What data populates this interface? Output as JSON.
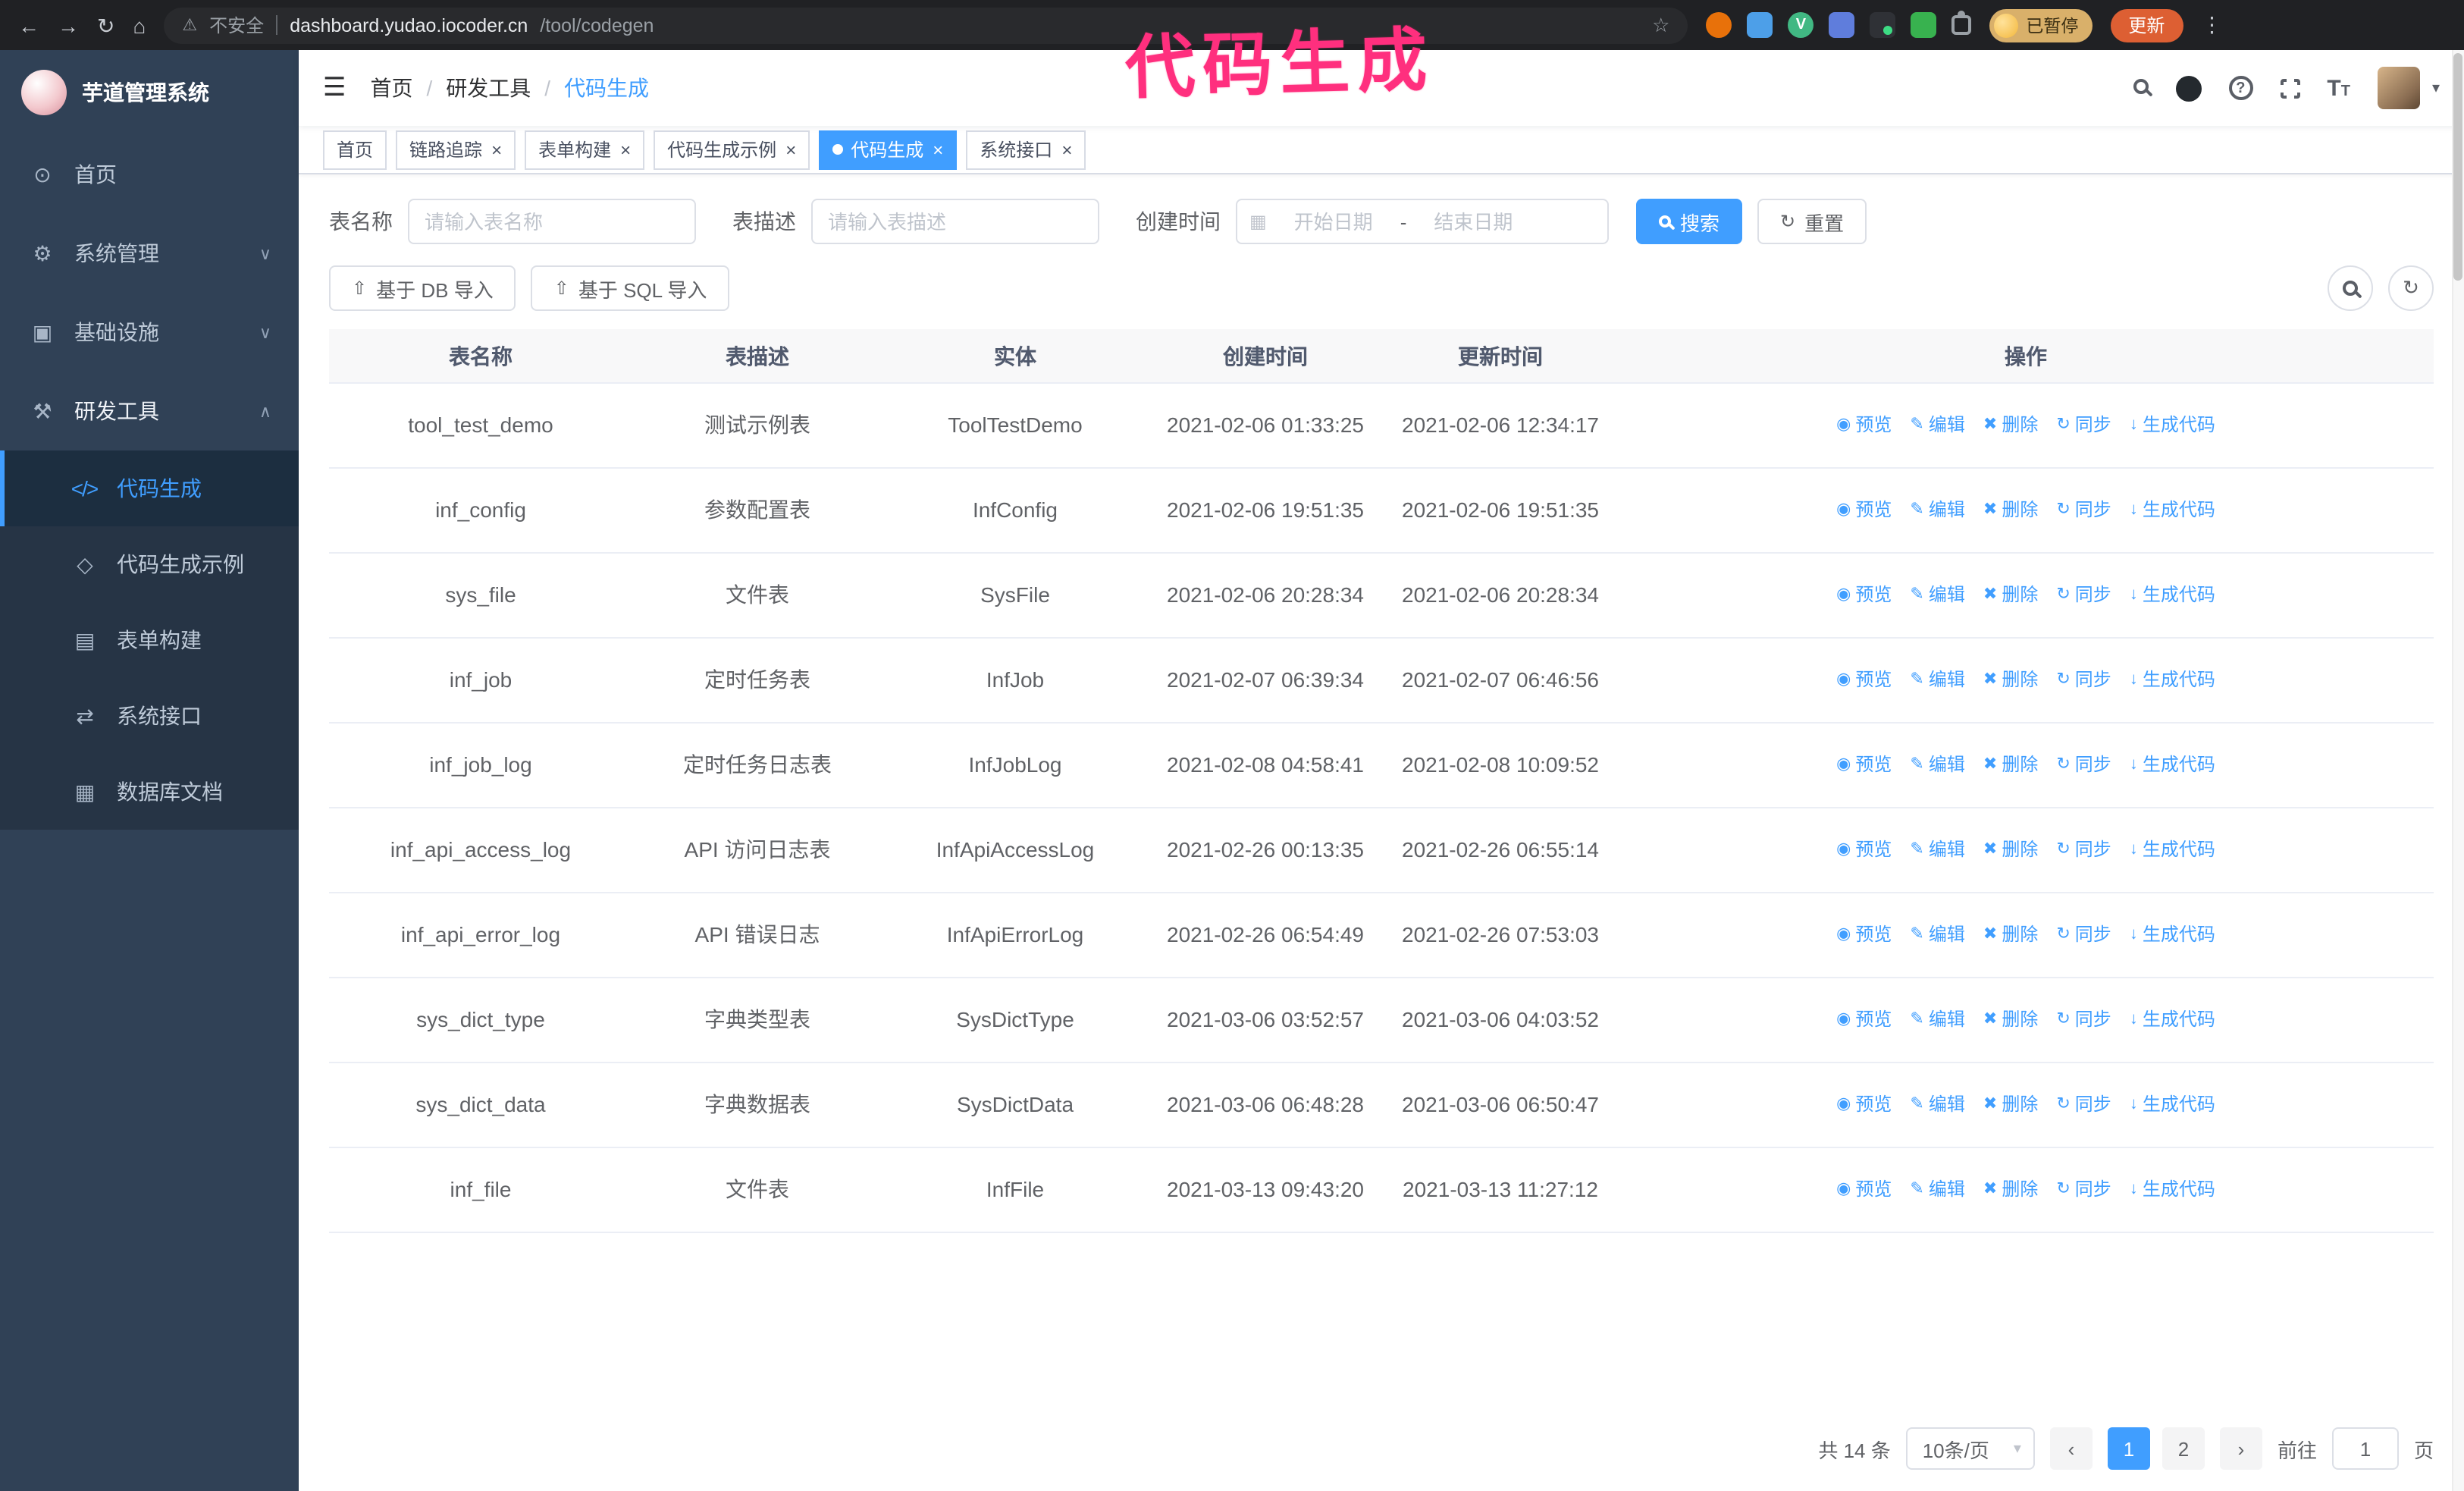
{
  "theme": {
    "accent": "#409eff",
    "sidebar_bg": "#304156",
    "submenu_bg": "#263445",
    "annotation_pink": "#ff2f7e",
    "chrome_bg": "#202124",
    "update_button_bg": "#dd5f33",
    "paused_chip_bg": "#d9b06a"
  },
  "annotation": {
    "text": "代码生成"
  },
  "browser": {
    "security_label": "不安全",
    "url_domain": "dashboard.yudao.iocoder.cn",
    "url_path": "/tool/codegen",
    "paused_badge": "已暂停",
    "update_button": "更新"
  },
  "icons": {
    "back-icon": "←",
    "forward-icon": "→",
    "reload-icon": "↻",
    "home-icon": "⌂",
    "warning-icon": "⚠",
    "star-icon": "☆",
    "kebab-icon": "⋮",
    "hamburger-icon": "☰",
    "help-icon": "?",
    "caret-down-icon": "▾",
    "vue-icon": "V",
    "dashboard-icon": "⊙",
    "gear-icon": "⚙",
    "infra-icon": "▣",
    "tools-icon": "⚒",
    "code-icon": "</>",
    "example-icon": "◇",
    "form-icon": "▤",
    "api-icon": "⇄",
    "dbdoc-icon": "▦",
    "chevron-down-icon": "∨",
    "chevron-up-icon": "∧",
    "close-icon": "×",
    "dot-icon": "●",
    "upload-icon": "⇧",
    "calendar-icon": "▦",
    "refresh-icon": "↻",
    "eye-icon": "◉",
    "edit-icon": "✎",
    "delete-icon": "✖",
    "sync-icon": "↻",
    "generate-icon": "↓",
    "prev-icon": "‹",
    "next-icon": "›"
  },
  "sidebar": {
    "logo_title": "芋道管理系统",
    "items": [
      {
        "id": "home",
        "label": "首页",
        "icon": "dashboard-icon"
      },
      {
        "id": "system",
        "label": "系统管理",
        "icon": "gear-icon",
        "chevron": "down"
      },
      {
        "id": "infra",
        "label": "基础设施",
        "icon": "infra-icon",
        "chevron": "down"
      },
      {
        "id": "devtools",
        "label": "研发工具",
        "icon": "tools-icon",
        "chevron": "up",
        "expanded": true,
        "children": [
          {
            "id": "codegen",
            "label": "代码生成",
            "icon": "code-icon",
            "active": true
          },
          {
            "id": "codegen-example",
            "label": "代码生成示例",
            "icon": "example-icon"
          },
          {
            "id": "form-build",
            "label": "表单构建",
            "icon": "form-icon"
          },
          {
            "id": "api",
            "label": "系统接口",
            "icon": "api-icon"
          },
          {
            "id": "db-doc",
            "label": "数据库文档",
            "icon": "dbdoc-icon"
          }
        ]
      }
    ]
  },
  "header": {
    "breadcrumb": [
      "首页",
      "研发工具",
      "代码生成"
    ]
  },
  "tabs": [
    {
      "id": "home",
      "label": "首页",
      "closable": false
    },
    {
      "id": "trace",
      "label": "链路追踪",
      "closable": true
    },
    {
      "id": "form-build",
      "label": "表单构建",
      "closable": true
    },
    {
      "id": "codegen-example",
      "label": "代码生成示例",
      "closable": true
    },
    {
      "id": "codegen",
      "label": "代码生成",
      "closable": true,
      "active": true
    },
    {
      "id": "api",
      "label": "系统接口",
      "closable": true
    }
  ],
  "filters": {
    "table_name_label": "表名称",
    "table_name_placeholder": "请输入表名称",
    "table_desc_label": "表描述",
    "table_desc_placeholder": "请输入表描述",
    "create_time_label": "创建时间",
    "date_start_placeholder": "开始日期",
    "date_separator": "-",
    "date_end_placeholder": "结束日期",
    "search_button": "搜索",
    "reset_button": "重置"
  },
  "toolbar": {
    "import_db": "基于 DB 导入",
    "import_sql": "基于 SQL 导入"
  },
  "table": {
    "columns": [
      "表名称",
      "表描述",
      "实体",
      "创建时间",
      "更新时间",
      "操作"
    ],
    "actions": [
      {
        "id": "preview",
        "label": "预览",
        "icon": "eye-icon"
      },
      {
        "id": "edit",
        "label": "编辑",
        "icon": "edit-icon"
      },
      {
        "id": "delete",
        "label": "删除",
        "icon": "delete-icon"
      },
      {
        "id": "sync",
        "label": "同步",
        "icon": "sync-icon"
      },
      {
        "id": "generate",
        "label": "生成代码",
        "icon": "generate-icon"
      }
    ],
    "rows": [
      {
        "name": "tool_test_demo",
        "desc": "测试示例表",
        "entity": "ToolTestDemo",
        "created": "2021-02-06 01:33:25",
        "updated": "2021-02-06 12:34:17"
      },
      {
        "name": "inf_config",
        "desc": "参数配置表",
        "entity": "InfConfig",
        "created": "2021-02-06 19:51:35",
        "updated": "2021-02-06 19:51:35"
      },
      {
        "name": "sys_file",
        "desc": "文件表",
        "entity": "SysFile",
        "created": "2021-02-06 20:28:34",
        "updated": "2021-02-06 20:28:34"
      },
      {
        "name": "inf_job",
        "desc": "定时任务表",
        "entity": "InfJob",
        "created": "2021-02-07 06:39:34",
        "updated": "2021-02-07 06:46:56"
      },
      {
        "name": "inf_job_log",
        "desc": "定时任务日志表",
        "entity": "InfJobLog",
        "created": "2021-02-08 04:58:41",
        "updated": "2021-02-08 10:09:52"
      },
      {
        "name": "inf_api_access_log",
        "desc": "API 访问日志表",
        "entity": "InfApiAccessLog",
        "created": "2021-02-26 00:13:35",
        "updated": "2021-02-26 06:55:14"
      },
      {
        "name": "inf_api_error_log",
        "desc": "API 错误日志",
        "entity": "InfApiErrorLog",
        "created": "2021-02-26 06:54:49",
        "updated": "2021-02-26 07:53:03"
      },
      {
        "name": "sys_dict_type",
        "desc": "字典类型表",
        "entity": "SysDictType",
        "created": "2021-03-06 03:52:57",
        "updated": "2021-03-06 04:03:52"
      },
      {
        "name": "sys_dict_data",
        "desc": "字典数据表",
        "entity": "SysDictData",
        "created": "2021-03-06 06:48:28",
        "updated": "2021-03-06 06:50:47"
      },
      {
        "name": "inf_file",
        "desc": "文件表",
        "entity": "InfFile",
        "created": "2021-03-13 09:43:20",
        "updated": "2021-03-13 11:27:12"
      }
    ]
  },
  "pagination": {
    "total_label": "共 14 条",
    "page_size_label": "10条/页",
    "pages": [
      {
        "label": "1",
        "active": true
      },
      {
        "label": "2",
        "active": false
      }
    ],
    "goto_label": "前往",
    "goto_value": "1",
    "goto_unit": "页"
  }
}
